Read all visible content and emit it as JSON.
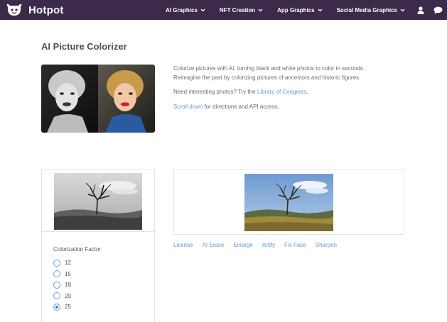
{
  "brand": {
    "name": "Hotpot",
    "icon": "hotpot-logo-icon"
  },
  "nav": {
    "items": [
      {
        "label": "AI Graphics"
      },
      {
        "label": "NFT Creation"
      },
      {
        "label": "App Graphics"
      },
      {
        "label": "Social Media Graphics"
      }
    ],
    "icons": [
      "user-icon",
      "chat-icon"
    ]
  },
  "page": {
    "title": "AI Picture Colorizer",
    "description": {
      "para1": "Colorize pictures with AI, turning black and white photos to color in seconds. Reimagine the past by colorizing pictures of ancestors and historic figures.",
      "para2_prefix": "Need interesting photos? Try the ",
      "para2_link": "Library of Congress",
      "para2_suffix": ".",
      "para3_link": "Scroll down",
      "para3_suffix": " for directions and API access."
    }
  },
  "settings": {
    "factor_label": "Colorization Factor",
    "options": [
      "12",
      "15",
      "18",
      "20",
      "25"
    ],
    "selected": "25"
  },
  "actions": [
    "License",
    "AI Erase",
    "Enlarge",
    "Artify",
    "Fix Face",
    "Sharpen"
  ],
  "colors": {
    "nav_bg": "#3b2a4a",
    "link": "#5b9bd5",
    "radio_checked": "#3d80c8"
  }
}
